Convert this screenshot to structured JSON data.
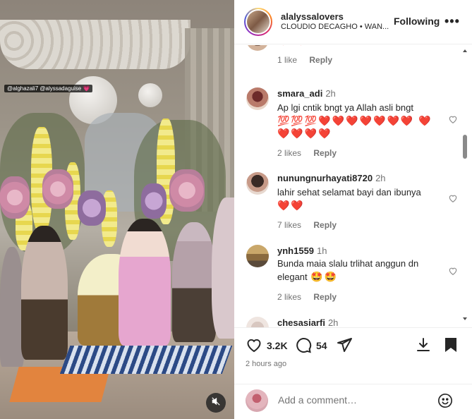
{
  "media": {
    "tag_text": "@alghazali7 @alyssadaguise",
    "tag_emoji": "💗",
    "mute_icon": "speaker-muted-icon"
  },
  "header": {
    "username": "alalyssalovers",
    "subtitle": "CLOUDIO DECAGHO • WAN...",
    "follow_label": "Following",
    "more_label": "•••"
  },
  "comments": [
    {
      "username": "",
      "time": "",
      "text": "",
      "emoji": "❤️ ❤️ 👏",
      "likes": "1 like",
      "reply": "Reply"
    },
    {
      "username": "smara_adi",
      "time": "2h",
      "text": "Ap lgi cntik bngt ya Allah asli bngt",
      "emoji": "💯💯💯❤️❤️❤️❤️❤️❤️❤️ ❤️❤️❤️❤️❤️",
      "likes": "2 likes",
      "reply": "Reply"
    },
    {
      "username": "nunungnurhayati8720",
      "time": "2h",
      "text": "lahir sehat selamat bayi dan ibunya",
      "emoji": "❤️❤️",
      "likes": "7 likes",
      "reply": "Reply"
    },
    {
      "username": "ynh1559",
      "time": "1h",
      "text": "Bunda maia slalu trlihat anggun dn elegant",
      "emoji": "🤩🤩",
      "likes": "2 likes",
      "reply": "Reply"
    },
    {
      "username": "chesasiarfi",
      "time": "2h",
      "text": "",
      "emoji": "",
      "likes": "",
      "reply": ""
    }
  ],
  "actions": {
    "like_count": "3.2K",
    "comment_count": "54",
    "posted": "2 hours ago"
  },
  "add_comment": {
    "placeholder": "Add a comment…"
  },
  "colors": {
    "heart_red": "#ed1c24",
    "text_primary": "#262626",
    "text_secondary": "#737373"
  }
}
